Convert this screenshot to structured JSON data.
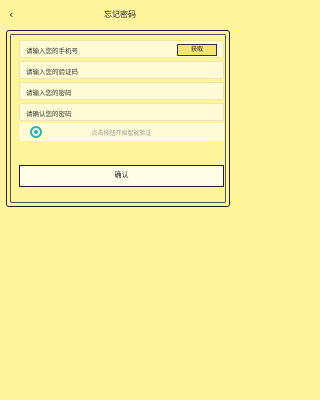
{
  "header": {
    "back_icon": "chevron-left-icon",
    "back_glyph": "‹",
    "title": "忘记密码"
  },
  "form": {
    "phone_placeholder": "请输入您的手机号",
    "get_code_label": "获取",
    "code_placeholder": "请输入您的验证码",
    "password_placeholder": "请输入您的密码",
    "confirm_password_placeholder": "请确认您的密码",
    "verify_text": "点击按钮开始智能验证",
    "confirm_label": "确认"
  },
  "colors": {
    "background": "#fdf49c",
    "accent": "#3bb4a8"
  }
}
